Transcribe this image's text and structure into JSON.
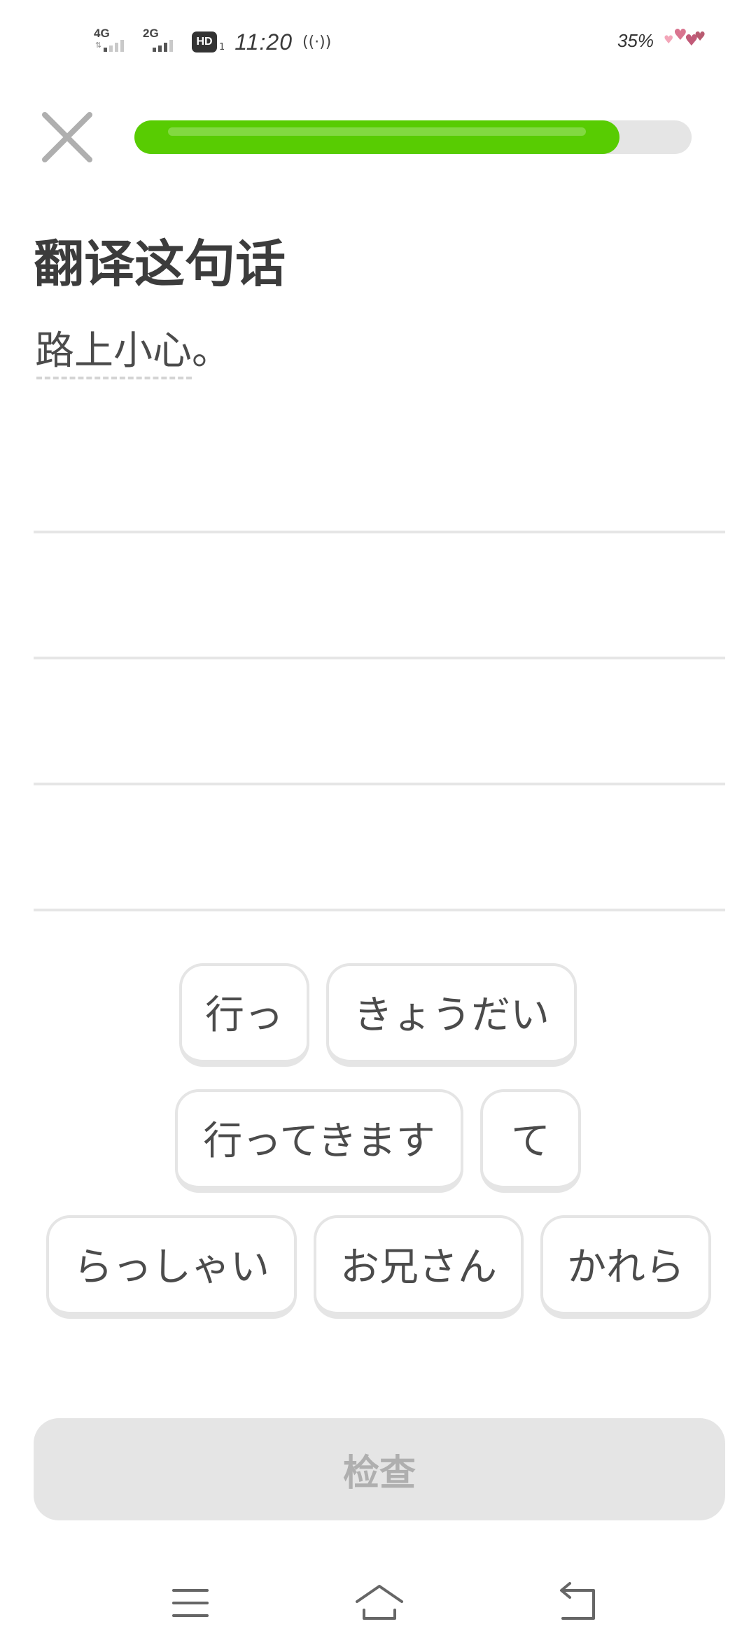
{
  "status_bar": {
    "network1": "4G",
    "network2": "2G",
    "hd_label": "HD",
    "hd_sub": "1",
    "time": "11:20",
    "hotspot_icon": "hotspot-icon",
    "battery": "35%",
    "battery_icon": "hearts-battery-icon"
  },
  "lesson": {
    "progress": 0.87,
    "title": "翻译这句话",
    "prompt": "路上小心。"
  },
  "word_bank": [
    "行っ",
    "きょうだい",
    "行ってきます",
    "て",
    "らっしゃい",
    "お兄さん",
    "かれら"
  ],
  "check_button": "检查",
  "colors": {
    "progress": "#58cc02",
    "track": "#e5e5e5",
    "text": "#4b4b4b",
    "button_disabled": "#e5e5e5",
    "button_text_disabled": "#afafaf"
  },
  "nav": {
    "menu_icon": "menu-icon",
    "home_icon": "home-icon",
    "back_icon": "back-icon"
  }
}
